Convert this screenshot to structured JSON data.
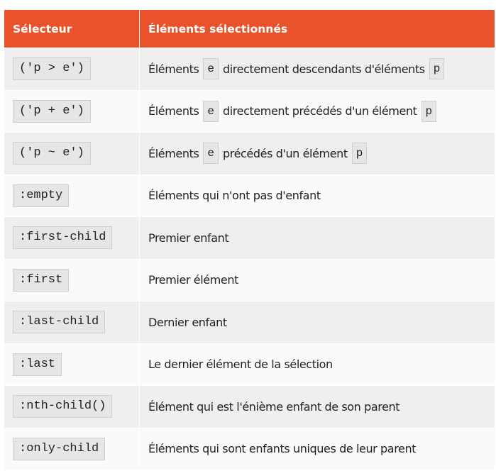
{
  "header": {
    "col1": "Sélecteur",
    "col2": "Éléments sélectionnés"
  },
  "rows": [
    {
      "selector": "('p > e')",
      "desc": {
        "a": "Éléments",
        "code1": "e",
        "b": "directement descendants d'éléments",
        "code2": "p"
      }
    },
    {
      "selector": "('p + e')",
      "desc": {
        "a": "Éléments",
        "code1": "e",
        "b": "directement précédés d'un élément",
        "code2": "p"
      }
    },
    {
      "selector": "('p ~ e')",
      "desc": {
        "a": "Éléments",
        "code1": "e",
        "b": "précédés d'un élément",
        "code2": "p"
      }
    },
    {
      "selector": ":empty",
      "desc": {
        "a": "Éléments qui n'ont pas d'enfant"
      }
    },
    {
      "selector": ":first-child",
      "desc": {
        "a": "Premier enfant"
      }
    },
    {
      "selector": ":first",
      "desc": {
        "a": "Premier élément"
      }
    },
    {
      "selector": ":last-child",
      "desc": {
        "a": "Dernier enfant"
      }
    },
    {
      "selector": ":last",
      "desc": {
        "a": "Le dernier élément de la sélection"
      }
    },
    {
      "selector": ":nth-child()",
      "desc": {
        "a": "Élément qui est l'énième enfant de son parent"
      }
    },
    {
      "selector": ":only-child",
      "desc": {
        "a": "Éléments qui sont enfants uniques de leur parent"
      }
    }
  ],
  "colors": {
    "header_bg": "#e8532b",
    "row_odd": "#efefef",
    "row_even": "#fafafa"
  }
}
